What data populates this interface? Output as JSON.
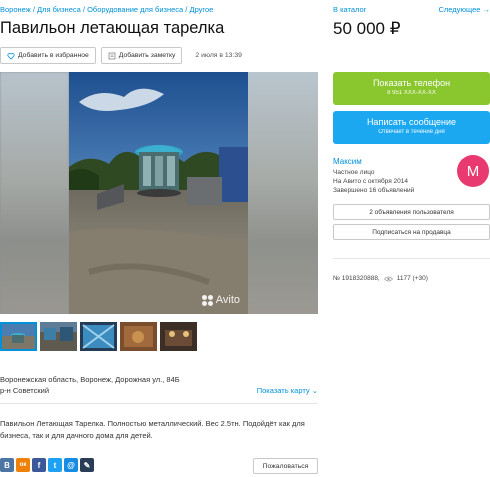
{
  "breadcrumb": [
    "Воронеж",
    "Для бизнеса",
    "Оборудование для бизнеса",
    "Другое"
  ],
  "title": "Павильон летающая тарелка",
  "actions": {
    "favorite_label": "Добавить в избранное",
    "note_label": "Добавить заметку",
    "date": "2 июля в 13:39"
  },
  "gallery": {
    "watermark": "Avito",
    "thumbnail_count": 5,
    "active_thumbnail": 1
  },
  "location": {
    "address": "Воронежская область, Воронеж, Дорожная ул., 84Б",
    "district": "р-н Советский",
    "show_map": "Показать карту"
  },
  "description": "Павильон Летающая Тарелка. Полностью металлический. Вес 2.5тн. Подойдёт как для бизнеса, так и для дачного дома для детей.",
  "share": {
    "icons": [
      {
        "name": "vk-icon",
        "glyph": "B",
        "color": "#4c75a3"
      },
      {
        "name": "ok-icon",
        "glyph": "ок",
        "color": "#ee8208"
      },
      {
        "name": "facebook-icon",
        "glyph": "f",
        "color": "#3b5998"
      },
      {
        "name": "twitter-icon",
        "glyph": "t",
        "color": "#1da1f2"
      },
      {
        "name": "mail-icon",
        "glyph": "@",
        "color": "#168de2"
      },
      {
        "name": "livejournal-icon",
        "glyph": "✎",
        "color": "#2a3d56"
      }
    ],
    "complain_label": "Пожаловаться"
  },
  "sidebar": {
    "catalog_link": "В каталог",
    "next_link": "Следующее →",
    "price": "50 000 ₽",
    "phone_button": {
      "main": "Показать телефон",
      "sub": "8 951 XXX-XX-XX"
    },
    "message_button": {
      "main": "Написать сообщение",
      "sub": "Отвечает в течение дня"
    },
    "seller": {
      "name": "Максим",
      "type": "Частное лицо",
      "since": "На Авито с октября 2014",
      "completed": "Завершено 16 объявлений",
      "avatar_letter": "М",
      "avatar_color": "#e83a70"
    },
    "user_ads_button": "2 объявления пользователя",
    "subscribe_button": "Подписаться на продавца",
    "ad_number": "№ 1918320888,",
    "views": "1177 (+30)"
  },
  "colors": {
    "link": "#0091d9",
    "phone_button": "#8ac62e",
    "message_button": "#1ba8f0"
  }
}
